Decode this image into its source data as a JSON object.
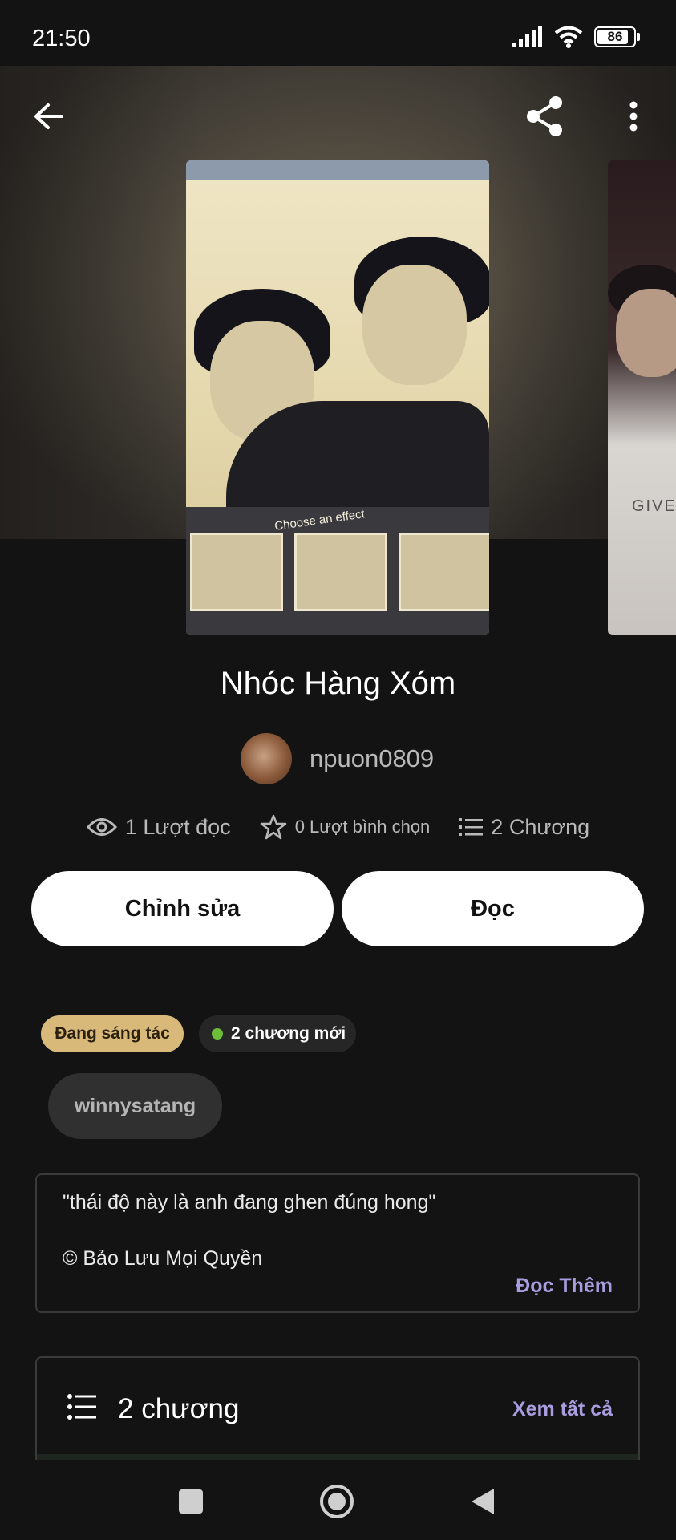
{
  "status_bar": {
    "time": "21:50",
    "battery": "86",
    "battery_level": 0.86
  },
  "story": {
    "title": "Nhóc Hàng Xóm",
    "author": "npuon0809",
    "cover_text": "Choose an effect",
    "side_cover_text": "GIVE"
  },
  "stats": {
    "reads": "1 Lượt đọc",
    "votes": "0 Lượt bình chọn",
    "chapters": "2 Chương"
  },
  "actions": {
    "edit_label": "Chỉnh sửa",
    "read_label": "Đọc"
  },
  "badges": {
    "status": "Đang sáng tác",
    "new_chapters": "2 chương mới"
  },
  "tags": [
    "winnysatang"
  ],
  "description": {
    "quote": "\"thái độ này là anh đang ghen đúng hong\"",
    "copyright": "© Bảo Lưu Mọi Quyền",
    "read_more": "Đọc Thêm"
  },
  "chapters_section": {
    "label": "2 chương",
    "see_all": "Xem tất cả"
  },
  "colors": {
    "accent": "#a99de0",
    "status_badge": "#d9b97a",
    "new_dot": "#6dbd3a",
    "background": "#131313"
  }
}
